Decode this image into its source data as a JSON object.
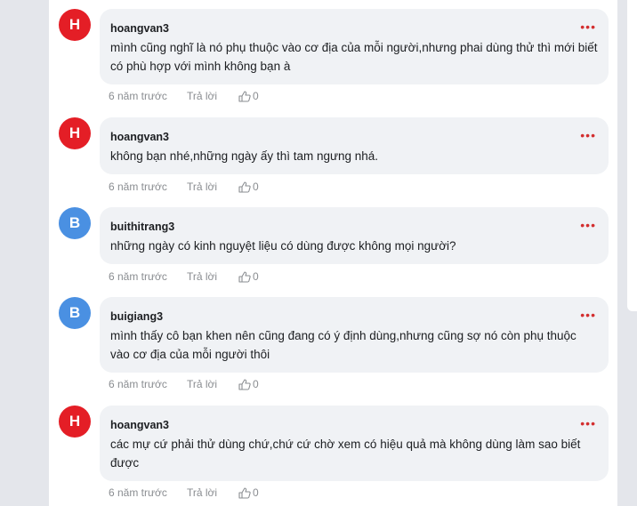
{
  "comments": [
    {
      "initial": "H",
      "avatar_color": "#e41e26",
      "author": "hoangvan3",
      "text": "mình cũng nghĩ là nó phụ thuộc vào cơ địa của mỗi người,nhưng phai dùng thử thì mới biết có phù hợp với mình không bạn à",
      "time": "6 năm trước",
      "reply_label": "Trả lời",
      "likes": "0",
      "more": "•••"
    },
    {
      "initial": "H",
      "avatar_color": "#e41e26",
      "author": "hoangvan3",
      "text": "không bạn nhé,những ngày ấy thì tam ngưng nhá.",
      "time": "6 năm trước",
      "reply_label": "Trả lời",
      "likes": "0",
      "more": "•••"
    },
    {
      "initial": "B",
      "avatar_color": "#4a90e2",
      "author": "buithitrang3",
      "text": "những ngày có kinh nguyệt liệu có dùng được không mọi người?",
      "time": "6 năm trước",
      "reply_label": "Trả lời",
      "likes": "0",
      "more": "•••"
    },
    {
      "initial": "B",
      "avatar_color": "#4a90e2",
      "author": "buigiang3",
      "text": "mình thấy cô bạn khen nên cũng đang có ý định dùng,nhưng cũng sợ nó còn phụ thuộc vào cơ địa của mỗi người thôi",
      "time": "6 năm trước",
      "reply_label": "Trả lời",
      "likes": "0",
      "more": "•••"
    },
    {
      "initial": "H",
      "avatar_color": "#e41e26",
      "author": "hoangvan3",
      "text": "các mự cứ phải thử dùng chứ,chứ cứ chờ xem có hiệu quả mà không dùng làm sao biết được",
      "time": "6 năm trước",
      "reply_label": "Trả lời",
      "likes": "0",
      "more": "•••"
    }
  ]
}
